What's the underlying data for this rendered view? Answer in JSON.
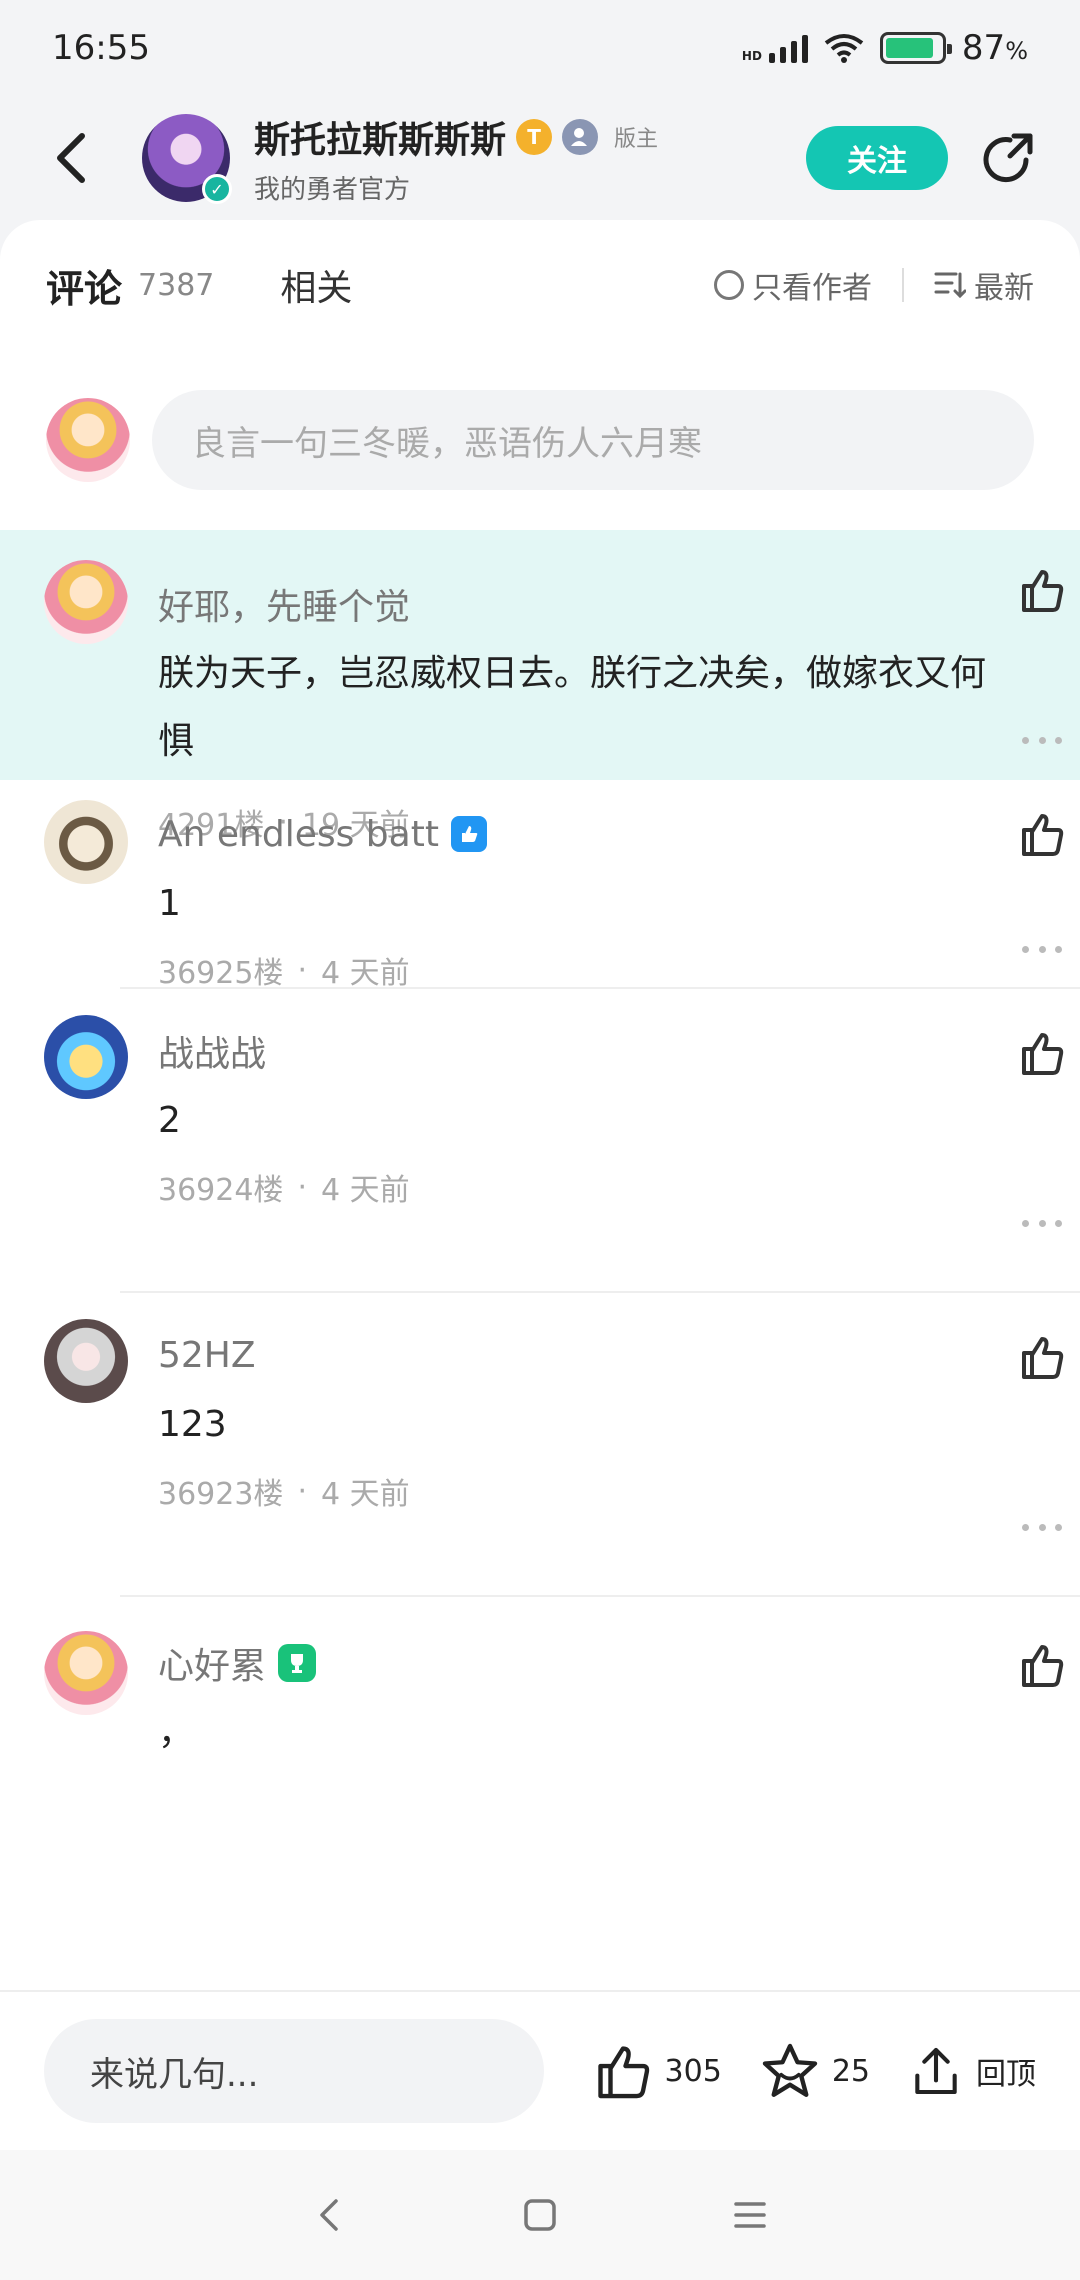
{
  "status": {
    "time": "16:55",
    "battery": "87",
    "battery_unit": "%",
    "network": "HD"
  },
  "header": {
    "name": "斯托拉斯斯斯斯",
    "subtitle": "我的勇者官方",
    "mod_label": "版主",
    "badge_letter": "T",
    "follow_label": "关注"
  },
  "tabs": {
    "comments_label": "评论",
    "comments_count": "7387",
    "related_label": "相关",
    "author_only_label": "只看作者",
    "sort_label": "最新"
  },
  "composer": {
    "placeholder": "良言一句三冬暖，恶语伤人六月寒"
  },
  "comments": [
    {
      "name": "好耶，先睡个觉",
      "text": "朕为天子，岂忍威权日去。朕行之决矣，做嫁衣又何惧",
      "floor": "4291楼",
      "time": "19 天前"
    },
    {
      "name": "An endless batt",
      "text": "1",
      "floor": "36925楼",
      "time": "4 天前"
    },
    {
      "name": "战战战",
      "text": "2",
      "floor": "36924楼",
      "time": "4 天前"
    },
    {
      "name": "52HZ",
      "text": "123",
      "floor": "36923楼",
      "time": "4 天前"
    },
    {
      "name": "心好累",
      "text": "，"
    }
  ],
  "meta_separator": "·",
  "bottom_bar": {
    "input_placeholder": "来说几句...",
    "likes_count": "305",
    "stars_count": "25",
    "top_label": "回顶"
  },
  "colors": {
    "accent": "#14c6b3",
    "highlight_bg": "#e3f7f5"
  }
}
